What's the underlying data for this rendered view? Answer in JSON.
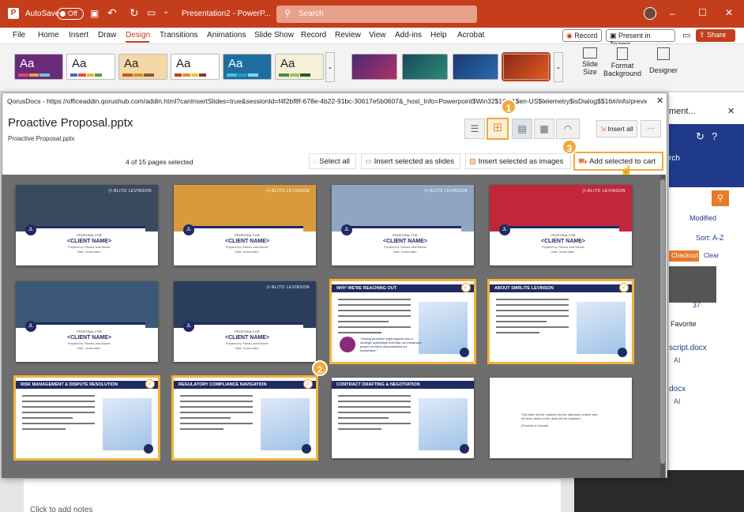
{
  "titlebar": {
    "autosave": "AutoSave",
    "toggle": "Off",
    "doc_title": "Presentation2 - PowerP...",
    "search_placeholder": "Search"
  },
  "window_controls": [
    "–",
    "☐",
    "✕"
  ],
  "menu": [
    "File",
    "Home",
    "Insert",
    "Draw",
    "Design",
    "Transitions",
    "Animations",
    "Slide Show",
    "Record",
    "Review",
    "View",
    "Add-ins",
    "Help",
    "Acrobat"
  ],
  "menu_active": "Design",
  "menu_right": {
    "record": "Record",
    "present": "Present in Teams",
    "share": "Share"
  },
  "ribbon": {
    "theme_label": "Aa",
    "slide_size": "Slide\nSize",
    "format_bg": "Format\nBackground",
    "designer": "Designer"
  },
  "dialog": {
    "url": "QorusDocs - https://officeaddin.qorushub.com/addin.html?canInsertSlides=true&sessionId=f4f2bf8f-678e-4b22-91bc-30617e5b0607&_host_Info=Powerpoint$Win32$16.01$en-US$telemetry$isDialog$$16#/info/previe...",
    "close": "✕",
    "file_title": "Proactive Proposal.pptx",
    "file_sub": "Proactive Proposal.pptx",
    "insert_all": "Insert all",
    "more": "···",
    "selected_count": "4 of 15 pages selected",
    "select_all": "Select all",
    "insert_slides": "Insert selected as slides",
    "insert_images": "Insert selected as images",
    "add_cart": "Add selected to cart"
  },
  "badges": [
    "1",
    "2",
    "3"
  ],
  "slides": [
    {
      "type": "cover",
      "brand": "(I-RLITO LEVINSON",
      "label": "PROPOSAL FOR",
      "name": "<CLIENT NAME>",
      "prep": "Prepared by: Pamela Jane Banner",
      "date": "Date: <Insert date>",
      "selected": false,
      "photo": "#3a4a5e"
    },
    {
      "type": "cover",
      "brand": "(I-RLITO LEVINSON",
      "label": "PROPOSAL FOR",
      "name": "<CLIENT NAME>",
      "prep": "Prepared by: Pamela Jane Banner",
      "date": "Date: <Insert date>",
      "selected": false,
      "photo": "#d99a3d"
    },
    {
      "type": "cover",
      "brand": "(I-RLITO LEVINSON",
      "label": "PROPOSAL FOR",
      "name": "<CLIENT NAME>",
      "prep": "Prepared by: Pamela Jane Banner",
      "date": "Date: <Insert date>",
      "selected": false,
      "photo": "#8fa6c2"
    },
    {
      "type": "cover",
      "brand": "(I-RLITO LEVINSON",
      "label": "PROPOSAL FOR",
      "name": "<CLIENT NAME>",
      "prep": "Prepared by: Pamela Jane Banner",
      "date": "Date: <Insert date>",
      "selected": false,
      "photo": "#c0283a"
    },
    {
      "type": "cover",
      "brand": "",
      "label": "PROPOSAL FOR",
      "name": "<CLIENT NAME>",
      "prep": "Prepared by: Pamela Jane Banner",
      "date": "Date: <Insert date>",
      "selected": false,
      "photo": "#3c5878"
    },
    {
      "type": "cover",
      "brand": "(I-RLITO LEVINSON",
      "label": "PROPOSAL FOR",
      "name": "<CLIENT NAME>",
      "prep": "Prepared by: Pamela Jane Banner",
      "date": "Date: <Insert date>",
      "selected": false,
      "photo": "#2a3d5c"
    },
    {
      "type": "content",
      "title": "WHY WE'RE REACHING OUT",
      "quote": "\"Having proactive legal support was a strategic advantage that kept our expansion project on track and protected our investment.\"",
      "selected": true
    },
    {
      "type": "content",
      "title": "ABOUT SMRLITE LEVINSON",
      "selected": true
    },
    {
      "type": "content",
      "title": "RISK MANAGEMENT & DISPUTE RESOLUTION",
      "selected": true
    },
    {
      "type": "content",
      "title": "REGULATORY COMPLIANCE NAVIGATION",
      "selected": true
    },
    {
      "type": "content",
      "title": "CONTRACT DRAFTING & NEGOTIATION",
      "selected": false
    },
    {
      "type": "blank",
      "text": "This slide will be replaced by the standard content and all other slides in the deck will be replaced.",
      "sub": "(Provide to include)",
      "selected": false
    }
  ],
  "right_pane": {
    "header": "ment...",
    "search": "rch",
    "modified": "Modified",
    "sort": "Sort: A-Z",
    "checkout": "Checkout",
    "clear": "Clear",
    "count": "37",
    "favorite": "Favorite",
    "file1": "script.docx",
    "file2": "docx",
    "ai": "AI"
  },
  "notes": "Click to add notes"
}
